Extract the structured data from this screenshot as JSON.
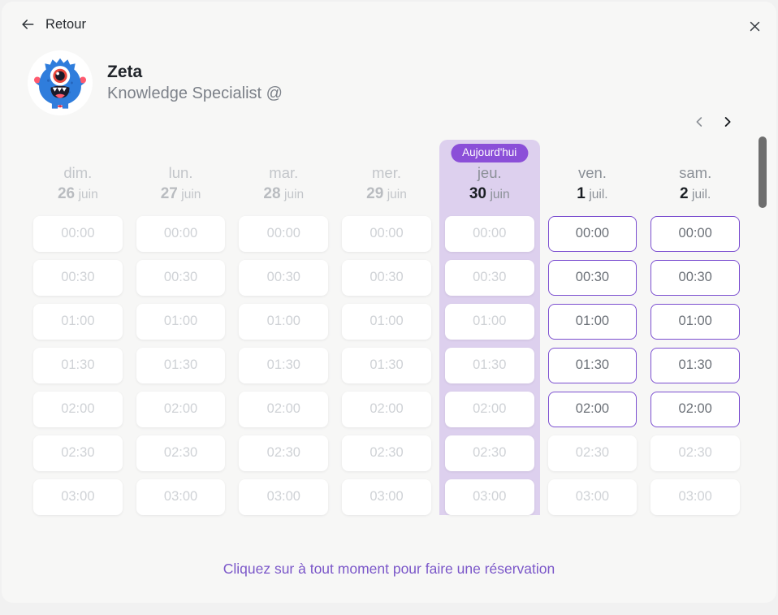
{
  "topbar": {
    "back_label": "Retour",
    "back_icon": "arrow-left-icon",
    "close_icon": "close-icon"
  },
  "profile": {
    "name": "Zeta",
    "role": "Knowledge Specialist @",
    "avatar_icon": "monster-avatar"
  },
  "nav": {
    "prev_icon": "chevron-left-icon",
    "next_icon": "chevron-right-icon"
  },
  "calendar": {
    "today_badge": "Aujourd'hui",
    "times": [
      "00:00",
      "00:30",
      "01:00",
      "01:30",
      "02:00",
      "02:30",
      "03:00"
    ],
    "days": [
      {
        "day_name": "dim.",
        "day_num": "26",
        "month": "juin",
        "state": "past",
        "is_today": false,
        "slots": [
          {
            "time": "00:00",
            "enabled": false
          },
          {
            "time": "00:30",
            "enabled": false
          },
          {
            "time": "01:00",
            "enabled": false
          },
          {
            "time": "01:30",
            "enabled": false
          },
          {
            "time": "02:00",
            "enabled": false
          },
          {
            "time": "02:30",
            "enabled": false
          },
          {
            "time": "03:00",
            "enabled": false
          }
        ]
      },
      {
        "day_name": "lun.",
        "day_num": "27",
        "month": "juin",
        "state": "past",
        "is_today": false,
        "slots": [
          {
            "time": "00:00",
            "enabled": false
          },
          {
            "time": "00:30",
            "enabled": false
          },
          {
            "time": "01:00",
            "enabled": false
          },
          {
            "time": "01:30",
            "enabled": false
          },
          {
            "time": "02:00",
            "enabled": false
          },
          {
            "time": "02:30",
            "enabled": false
          },
          {
            "time": "03:00",
            "enabled": false
          }
        ]
      },
      {
        "day_name": "mar.",
        "day_num": "28",
        "month": "juin",
        "state": "past",
        "is_today": false,
        "slots": [
          {
            "time": "00:00",
            "enabled": false
          },
          {
            "time": "00:30",
            "enabled": false
          },
          {
            "time": "01:00",
            "enabled": false
          },
          {
            "time": "01:30",
            "enabled": false
          },
          {
            "time": "02:00",
            "enabled": false
          },
          {
            "time": "02:30",
            "enabled": false
          },
          {
            "time": "03:00",
            "enabled": false
          }
        ]
      },
      {
        "day_name": "mer.",
        "day_num": "29",
        "month": "juin",
        "state": "past",
        "is_today": false,
        "slots": [
          {
            "time": "00:00",
            "enabled": false
          },
          {
            "time": "00:30",
            "enabled": false
          },
          {
            "time": "01:00",
            "enabled": false
          },
          {
            "time": "01:30",
            "enabled": false
          },
          {
            "time": "02:00",
            "enabled": false
          },
          {
            "time": "02:30",
            "enabled": false
          },
          {
            "time": "03:00",
            "enabled": false
          }
        ]
      },
      {
        "day_name": "jeu.",
        "day_num": "30",
        "month": "juin",
        "state": "today",
        "is_today": true,
        "slots": [
          {
            "time": "00:00",
            "enabled": false
          },
          {
            "time": "00:30",
            "enabled": false
          },
          {
            "time": "01:00",
            "enabled": false
          },
          {
            "time": "01:30",
            "enabled": false
          },
          {
            "time": "02:00",
            "enabled": false
          },
          {
            "time": "02:30",
            "enabled": false
          },
          {
            "time": "03:00",
            "enabled": false
          }
        ]
      },
      {
        "day_name": "ven.",
        "day_num": "1",
        "month": "juil.",
        "state": "future",
        "is_today": false,
        "slots": [
          {
            "time": "00:00",
            "enabled": true
          },
          {
            "time": "00:30",
            "enabled": true
          },
          {
            "time": "01:00",
            "enabled": true
          },
          {
            "time": "01:30",
            "enabled": true
          },
          {
            "time": "02:00",
            "enabled": true
          },
          {
            "time": "02:30",
            "enabled": false
          },
          {
            "time": "03:00",
            "enabled": false
          }
        ]
      },
      {
        "day_name": "sam.",
        "day_num": "2",
        "month": "juil.",
        "state": "future",
        "is_today": false,
        "slots": [
          {
            "time": "00:00",
            "enabled": true
          },
          {
            "time": "00:30",
            "enabled": true
          },
          {
            "time": "01:00",
            "enabled": true
          },
          {
            "time": "01:30",
            "enabled": true
          },
          {
            "time": "02:00",
            "enabled": true
          },
          {
            "time": "02:30",
            "enabled": false
          },
          {
            "time": "03:00",
            "enabled": false
          }
        ]
      }
    ]
  },
  "footer": {
    "note": "Cliquez sur à tout moment pour faire une réservation"
  },
  "colors": {
    "accent_purple": "#8b4fd8",
    "slot_border_purple": "#7c4fd0",
    "today_column_bg": "#ddd0ee",
    "footer_text": "#7b57c9",
    "page_bg": "#f1f1f1",
    "card_bg": "#f7f7f6",
    "scrollbar_thumb": "#6e6e6e"
  }
}
